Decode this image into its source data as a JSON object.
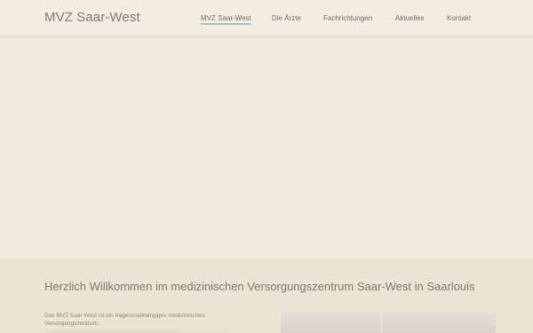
{
  "header": {
    "logo_text": "MVZ Saar-West",
    "nav": [
      {
        "label": "MVZ Saar-West",
        "active": true
      },
      {
        "label": "Die Ärzte",
        "active": false
      },
      {
        "label": "Fachrichtungen",
        "active": false
      },
      {
        "label": "Aktuelles",
        "active": false
      },
      {
        "label": "Kontakt",
        "active": false
      }
    ]
  },
  "main": {
    "title": "Herzlich Willkommen im medizinischen Versorgungszentrum Saar-West in Saarlouis",
    "intro": "Das MVZ Saar West ist ein trägerunabhängiges medizinisches Versorgungszentrum."
  },
  "colors": {
    "background": "#f1ebdf",
    "section_background": "#ebe4d0",
    "nav_active_underline": "#a7c2b7"
  }
}
